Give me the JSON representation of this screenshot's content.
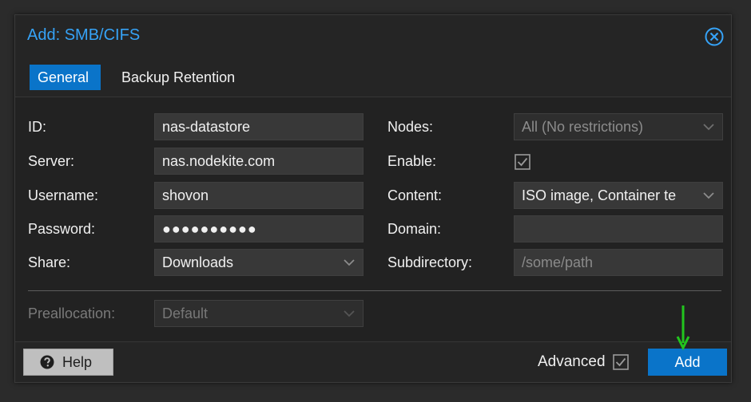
{
  "dialog": {
    "title": "Add: SMB/CIFS",
    "accent_color": "#36a3f7",
    "close_icon": "close-circle-icon"
  },
  "tabs": [
    {
      "label": "General",
      "active": true
    },
    {
      "label": "Backup Retention",
      "active": false
    }
  ],
  "form": {
    "id": {
      "label": "ID:",
      "value": "nas-datastore"
    },
    "server": {
      "label": "Server:",
      "value": "nas.nodekite.com"
    },
    "username": {
      "label": "Username:",
      "value": "shovon"
    },
    "password": {
      "label": "Password:",
      "value": "●●●●●●●●●●"
    },
    "share": {
      "label": "Share:",
      "value": "Downloads"
    },
    "nodes": {
      "label": "Nodes:",
      "value": "All (No restrictions)"
    },
    "enable": {
      "label": "Enable:",
      "checked": true
    },
    "content": {
      "label": "Content:",
      "value": "ISO image, Container te"
    },
    "domain": {
      "label": "Domain:",
      "value": ""
    },
    "subdirectory": {
      "label": "Subdirectory:",
      "placeholder": "/some/path"
    },
    "preallocation": {
      "label": "Preallocation:",
      "value": "Default"
    }
  },
  "footer": {
    "help_label": "Help",
    "advanced_label": "Advanced",
    "advanced_checked": true,
    "add_label": "Add",
    "button_color": "#0a74c9"
  },
  "annotation": {
    "arrow_color": "#22c51e"
  }
}
